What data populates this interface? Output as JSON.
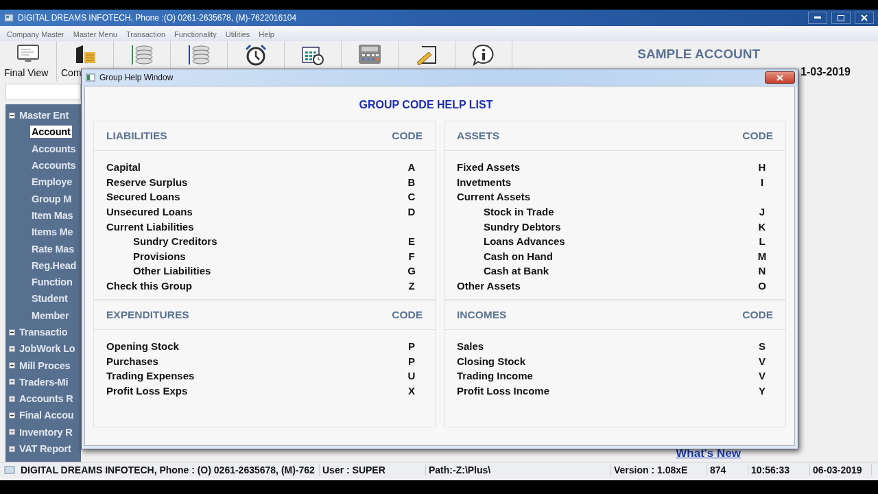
{
  "window": {
    "title": "DIGITAL DREAMS INFOTECH, Phone :(O) 0261-2635678, (M)-7622016104"
  },
  "menu": [
    "Company Master",
    "Master Menu",
    "Transaction",
    "Functionality",
    "Utilities",
    "Help"
  ],
  "toolbar": [
    {
      "kind": "monitor",
      "label": "Final View"
    },
    {
      "kind": "company",
      "label": "Com"
    },
    {
      "kind": "coins-green"
    },
    {
      "kind": "coins-blue"
    },
    {
      "kind": "clock"
    },
    {
      "kind": "calendar"
    },
    {
      "kind": "calculator"
    },
    {
      "kind": "pencil"
    },
    {
      "kind": "info"
    }
  ],
  "header": {
    "company": "SAMPLE ACCOUNT",
    "date": "1-03-2019"
  },
  "tree": [
    {
      "label": "Master Ent",
      "expanded": true,
      "selected": false,
      "children": [
        {
          "label": "Account",
          "selected": true
        },
        {
          "label": "Accounts",
          "selected": false
        },
        {
          "label": "Accounts",
          "selected": false
        },
        {
          "label": "Employe",
          "selected": false
        },
        {
          "label": "Group M",
          "selected": false
        },
        {
          "label": "Item Mas",
          "selected": false
        },
        {
          "label": "Items Me",
          "selected": false
        },
        {
          "label": "Rate Mas",
          "selected": false
        },
        {
          "label": "Reg.Head",
          "selected": false
        },
        {
          "label": "Function",
          "selected": false
        },
        {
          "label": "Student",
          "selected": false
        },
        {
          "label": "Member",
          "selected": false
        }
      ]
    },
    {
      "label": "Transactio",
      "expanded": false,
      "selected": false
    },
    {
      "label": "JobWork Lo",
      "expanded": false,
      "selected": false
    },
    {
      "label": "Mill Proces",
      "expanded": false,
      "selected": false
    },
    {
      "label": "Traders-Mi",
      "expanded": false,
      "selected": false
    },
    {
      "label": "Accounts R",
      "expanded": false,
      "selected": false
    },
    {
      "label": "Final Accou",
      "expanded": false,
      "selected": false
    },
    {
      "label": "Inventory R",
      "expanded": false,
      "selected": false
    },
    {
      "label": "VAT Report",
      "expanded": false,
      "selected": false
    }
  ],
  "whats_new": "What's New",
  "dialog": {
    "title": "Group Help Window",
    "heading": "GROUP CODE HELP LIST",
    "columns": [
      [
        {
          "title": "LIABILITIES",
          "code_header": "CODE",
          "items": [
            {
              "name": "Capital",
              "code": "A"
            },
            {
              "name": "Reserve Surplus",
              "code": "B"
            },
            {
              "name": "Secured Loans",
              "code": "C"
            },
            {
              "name": "Unsecured Loans",
              "code": "D"
            },
            {
              "name": "Current Liabilities",
              "children": [
                {
                  "name": "Sundry Creditors",
                  "code": "E"
                },
                {
                  "name": "Provisions",
                  "code": "F"
                },
                {
                  "name": "Other Liabilities",
                  "code": "G"
                }
              ]
            },
            {
              "name": "Check this Group",
              "code": "Z"
            }
          ]
        },
        {
          "title": "EXPENDITURES",
          "code_header": "CODE",
          "items": [
            {
              "name": "Opening Stock",
              "code": "P"
            },
            {
              "name": "Purchases",
              "code": "P"
            },
            {
              "name": "Trading Expenses",
              "code": "U"
            },
            {
              "name": "Profit Loss Exps",
              "code": "X"
            }
          ]
        }
      ],
      [
        {
          "title": "ASSETS",
          "code_header": "CODE",
          "items": [
            {
              "name": "Fixed Assets",
              "code": "H"
            },
            {
              "name": "Invetments",
              "code": "I"
            },
            {
              "name": "Current Assets",
              "children": [
                {
                  "name": "Stock in Trade",
                  "code": "J"
                },
                {
                  "name": "Sundry Debtors",
                  "code": "K"
                },
                {
                  "name": "Loans Advances",
                  "code": "L"
                },
                {
                  "name": "Cash on Hand",
                  "code": "M"
                },
                {
                  "name": "Cash at Bank",
                  "code": "N"
                }
              ]
            },
            {
              "name": "Other Assets",
              "code": "O"
            }
          ]
        },
        {
          "title": "INCOMES",
          "code_header": "CODE",
          "items": [
            {
              "name": "Sales",
              "code": "S"
            },
            {
              "name": "Closing Stock",
              "code": "V"
            },
            {
              "name": "Trading Income",
              "code": "V"
            },
            {
              "name": "Profit Loss Income",
              "code": "Y"
            }
          ]
        }
      ]
    ]
  },
  "status_bar": [
    "DIGITAL DREAMS INFOTECH, Phone : (O) 0261-2635678, (M)-762",
    "User : SUPER",
    "Path:-Z:\\Plus\\",
    "Version : 1.08xE",
    "874",
    "10:56:33",
    "06-03-2019"
  ]
}
